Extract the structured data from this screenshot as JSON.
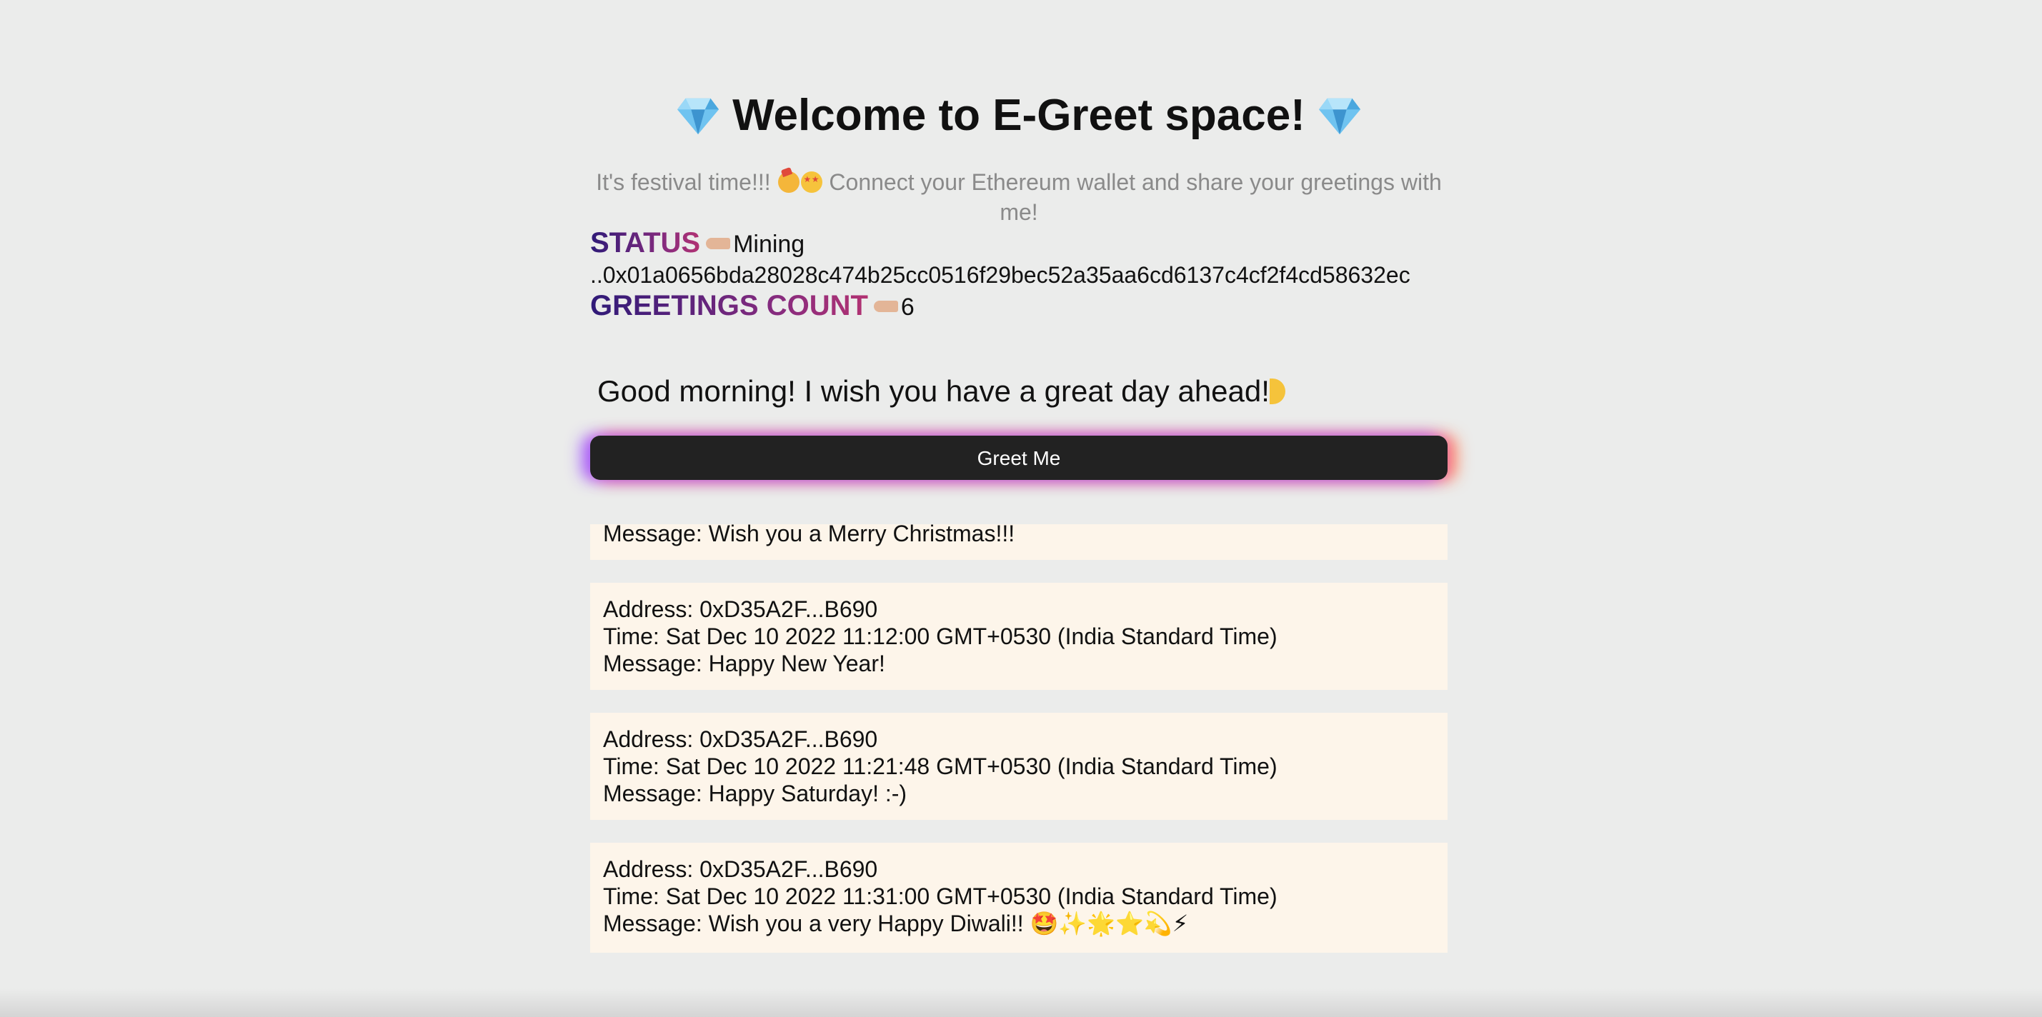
{
  "header": {
    "title": "Welcome to E-Greet space!",
    "subtitle": "It's festival time!!! 🥳🤩 Connect your Ethereum wallet and share your greetings with me!",
    "subtitle_part1": "It's festival time!!!",
    "subtitle_part2": "Connect your Ethereum wallet and share your greetings with me!"
  },
  "status": {
    "label": "STATUS",
    "value": "Mining",
    "hash": "..0x01a0656bda28028c474b25cc0516f29bec52a35aa6cd6137c4cf2f4cd58632ec"
  },
  "greetings_count": {
    "label": "GREETINGS COUNT",
    "value": "6"
  },
  "greeting_input": {
    "text": "Good morning!  I wish you have a great day ahead!"
  },
  "greet_button": {
    "label": "Greet Me"
  },
  "greetings": [
    {
      "message": "Message: Wish you a Merry Christmas!!!"
    },
    {
      "address": "Address: 0xD35A2F...B690",
      "time": "Time: Sat Dec 10 2022 11:12:00 GMT+0530 (India Standard Time)",
      "message": "Message: Happy New Year!"
    },
    {
      "address": "Address: 0xD35A2F...B690",
      "time": "Time: Sat Dec 10 2022 11:21:48 GMT+0530 (India Standard Time)",
      "message": "Message: Happy Saturday! :-)"
    },
    {
      "address": "Address: 0xD35A2F...B690",
      "time": "Time: Sat Dec 10 2022 11:31:00 GMT+0530 (India Standard Time)",
      "message": "Message: Wish you a very Happy Diwali!!",
      "emojis": "🤩✨🌟⭐💫⚡"
    }
  ],
  "icons": {
    "gem": "gem-icon",
    "pointing": "backhand-index-pointing-right-icon"
  },
  "colors": {
    "background": "#ebeceb",
    "card": "#fdf5ea",
    "button": "#222222",
    "label_gradient_start": "#2f1a78",
    "label_gradient_end": "#b23272"
  }
}
